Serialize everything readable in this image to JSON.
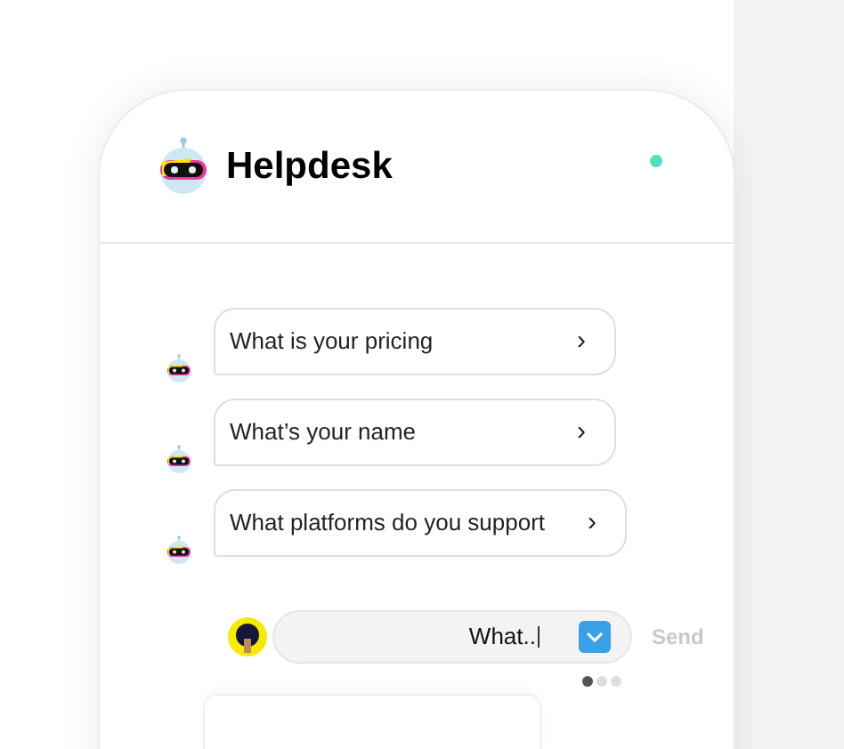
{
  "header": {
    "title": "Helpdesk",
    "online": true
  },
  "suggestions": [
    {
      "text": "What is your pricing",
      "arrow": "›"
    },
    {
      "text": "What’s your name",
      "arrow": "›"
    },
    {
      "text": "What platforms do you support",
      "arrow": "›"
    }
  ],
  "composer": {
    "value": "What..",
    "send": "Send"
  },
  "pager": [
    {
      "selected": true
    },
    {
      "selected": false
    },
    {
      "selected": false
    }
  ]
}
